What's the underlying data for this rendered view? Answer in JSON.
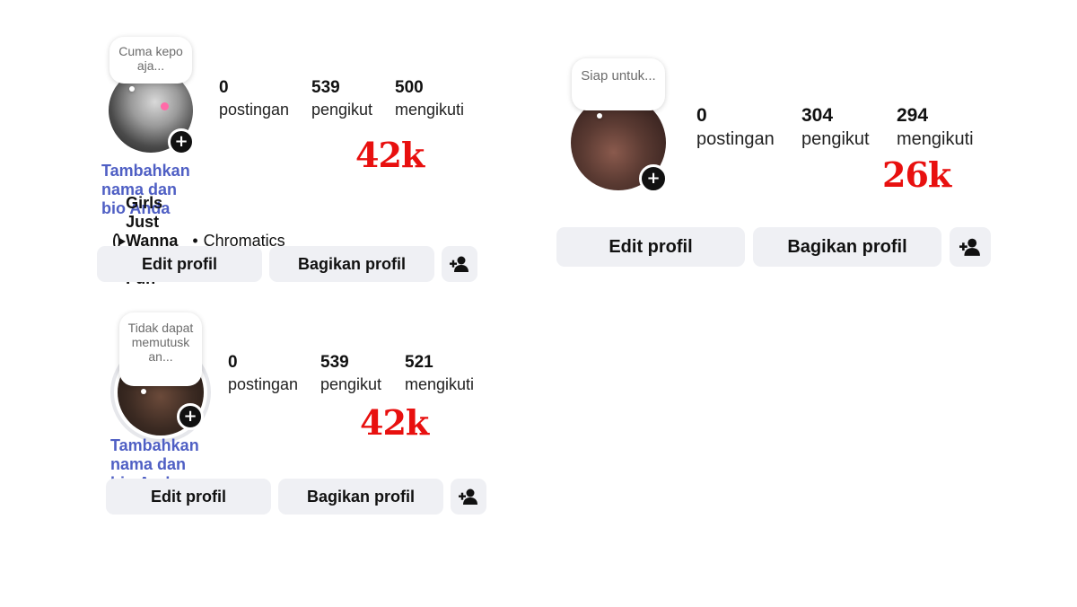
{
  "profile1": {
    "note": "Cuma kepo aja...",
    "stats": [
      {
        "num": "0",
        "label": "postingan"
      },
      {
        "num": "539",
        "label": "pengikut"
      },
      {
        "num": "500",
        "label": "mengikuti"
      }
    ],
    "bio_prompt": "Tambahkan nama dan bio Anda",
    "overlay": "42k",
    "music": {
      "song": "Girls Just Wanna Have Fun",
      "separator": "•",
      "artist": "Chromatics"
    },
    "buttons": {
      "edit": "Edit profil",
      "share": "Bagikan profil"
    }
  },
  "profile2": {
    "note": "Siap untuk...",
    "stats": [
      {
        "num": "0",
        "label": "postingan"
      },
      {
        "num": "304",
        "label": "pengikut"
      },
      {
        "num": "294",
        "label": "mengikuti"
      }
    ],
    "overlay": "26k",
    "buttons": {
      "edit": "Edit profil",
      "share": "Bagikan profil"
    }
  },
  "profile3": {
    "note": "Tidak dapat memutusk an...",
    "stats": [
      {
        "num": "0",
        "label": "postingan"
      },
      {
        "num": "539",
        "label": "pengikut"
      },
      {
        "num": "521",
        "label": "mengikuti"
      }
    ],
    "bio_prompt": "Tambahkan nama dan bio Anda",
    "overlay": "42k",
    "buttons": {
      "edit": "Edit profil",
      "share": "Bagikan profil"
    }
  },
  "icons": {
    "add_story": "plus-icon",
    "add_person": "add-person-icon",
    "music": "play-circle-icon"
  },
  "colors": {
    "bio_link": "#4f5fc4",
    "overlay_text": "#e8100f",
    "button_bg": "#eff0f4"
  }
}
